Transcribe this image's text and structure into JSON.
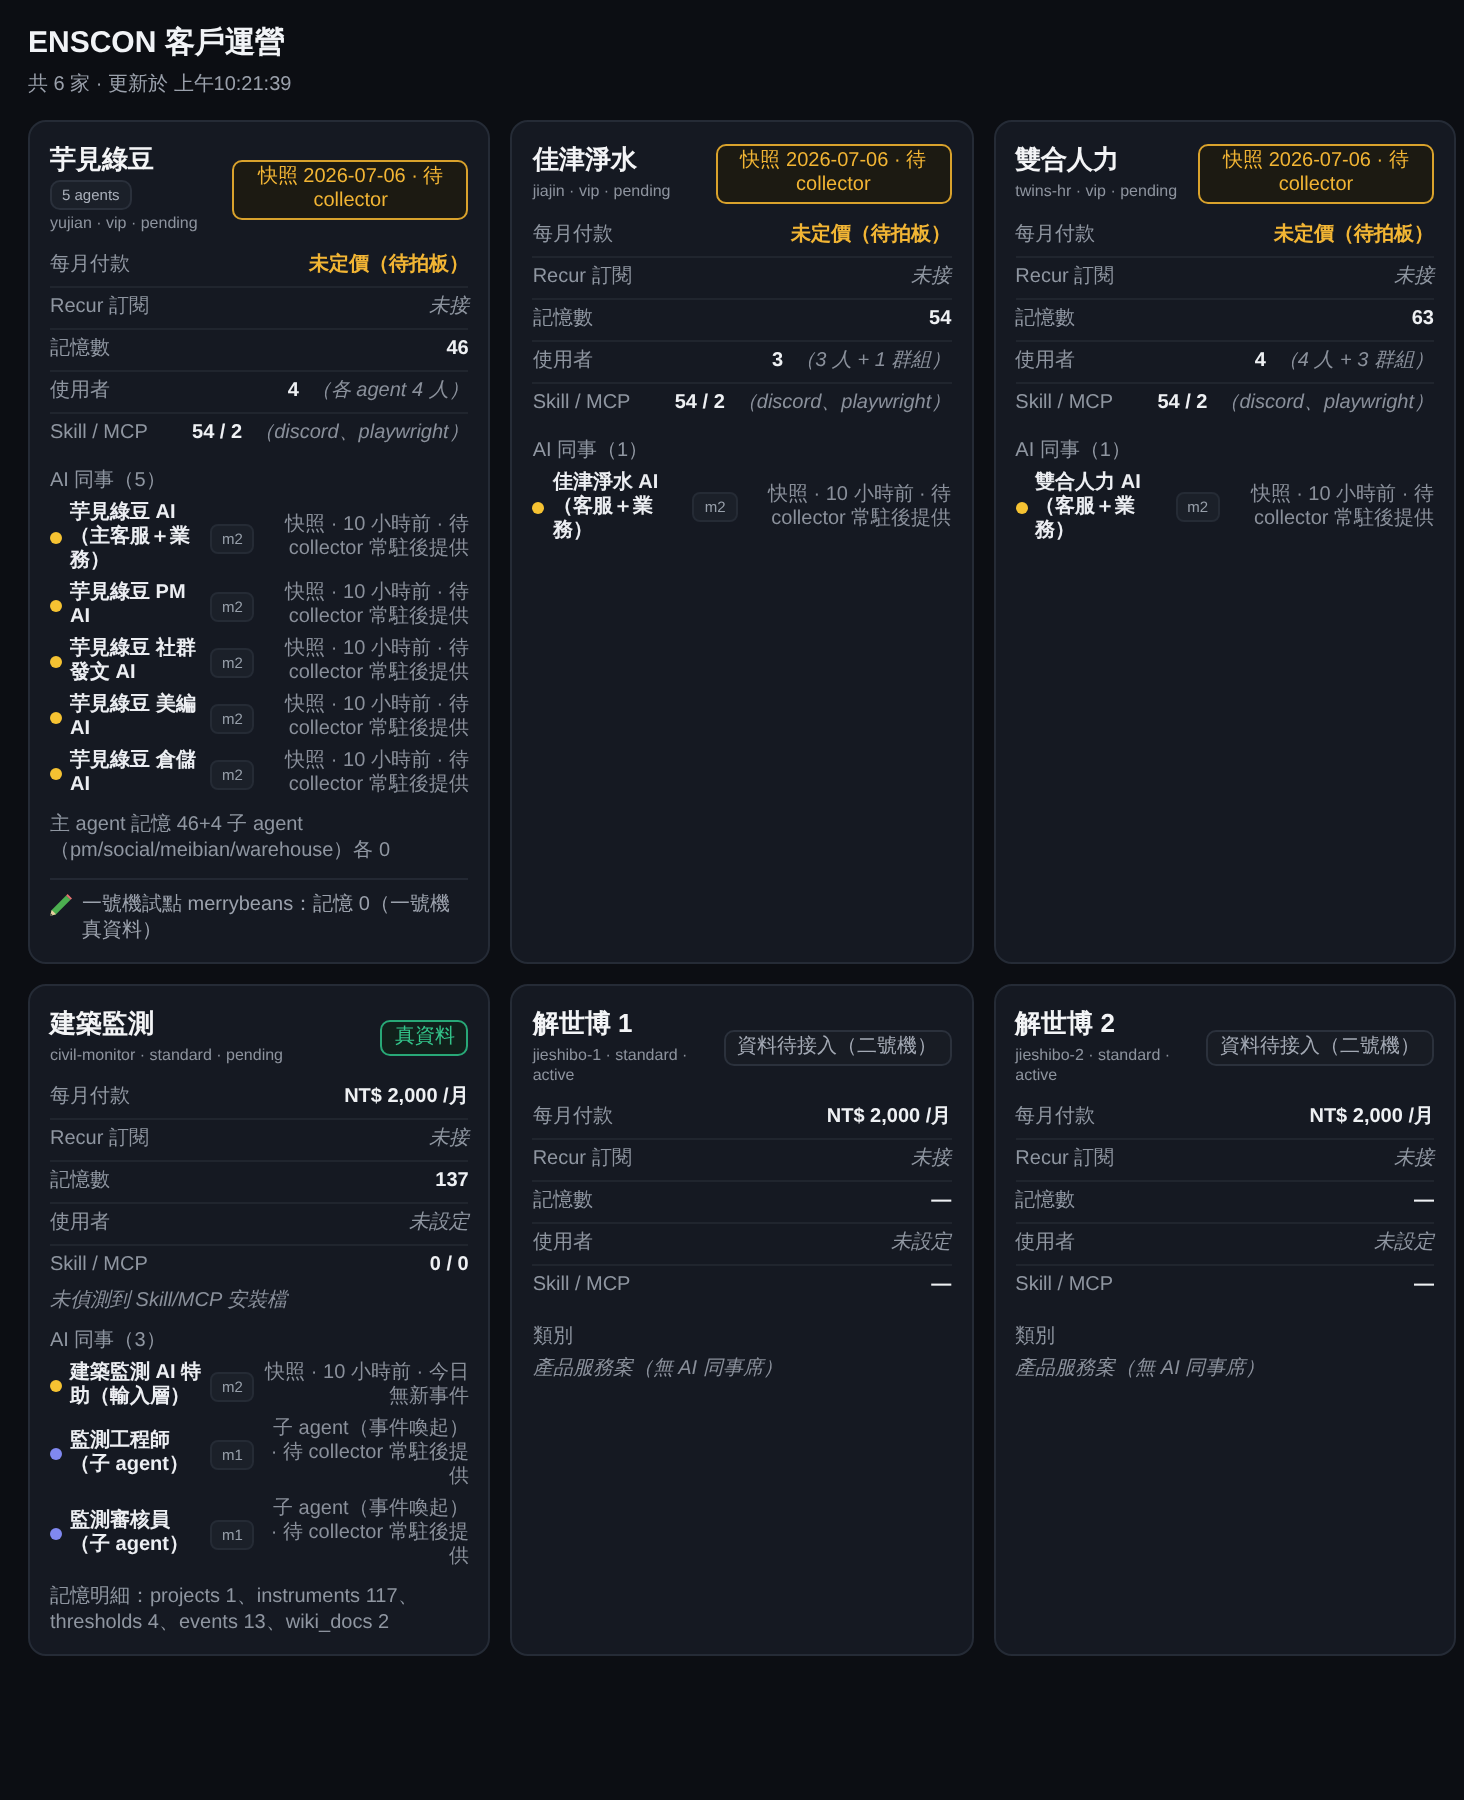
{
  "header": {
    "title": "ENSCON 客戶運營",
    "subtitle": "共 6 家 · 更新於 上午10:21:39"
  },
  "clients": [
    {
      "name": "芋見綠豆",
      "agent_count": "5 agents",
      "meta": "yujian · vip · pending",
      "badge": {
        "kind": "snapshot",
        "text": "快照 2026-07-06 · 待 collector"
      },
      "fields": [
        {
          "label": "每月付款",
          "value": "未定價（待拍板）",
          "kind": "price"
        },
        {
          "label": "Recur 訂閱",
          "value": "未接",
          "kind": "muted"
        },
        {
          "label": "記憶數",
          "value": "46",
          "kind": "strong"
        },
        {
          "label": "使用者",
          "value": "4",
          "kind": "strong",
          "note": "（各 agent 4 人）"
        },
        {
          "label": "Skill / MCP",
          "value": "54 / 2",
          "kind": "strong",
          "note": "（discord、playwright）"
        }
      ],
      "ai_team": {
        "title": "AI 同事（5）",
        "agents": [
          {
            "name": "芋見綠豆 AI（主客服＋業務）",
            "model": "m2",
            "status": "快照 · 10 小時前 · 待 collector 常駐後提供",
            "color": "#f5c232"
          },
          {
            "name": "芋見綠豆 PM AI",
            "model": "m2",
            "status": "快照 · 10 小時前 · 待 collector 常駐後提供",
            "color": "#f5c232"
          },
          {
            "name": "芋見綠豆 社群發文 AI",
            "model": "m2",
            "status": "快照 · 10 小時前 · 待 collector 常駐後提供",
            "color": "#f5c232"
          },
          {
            "name": "芋見綠豆 美編 AI",
            "model": "m2",
            "status": "快照 · 10 小時前 · 待 collector 常駐後提供",
            "color": "#f5c232"
          },
          {
            "name": "芋見綠豆 倉儲 AI",
            "model": "m2",
            "status": "快照 · 10 小時前 · 待 collector 常駐後提供",
            "color": "#f5c232"
          }
        ]
      },
      "notes": [
        {
          "kind": "detail",
          "text": "主 agent 記憶 46+4 子 agent（pm/social/meibian/warehouse）各 0"
        },
        {
          "kind": "pilot",
          "text": "一號機試點 merrybeans：記憶 0（一號機真資料）"
        }
      ]
    },
    {
      "name": "佳津淨水",
      "meta": "jiajin · vip · pending",
      "badge": {
        "kind": "snapshot",
        "text": "快照 2026-07-06 · 待 collector"
      },
      "fields": [
        {
          "label": "每月付款",
          "value": "未定價（待拍板）",
          "kind": "price"
        },
        {
          "label": "Recur 訂閱",
          "value": "未接",
          "kind": "muted"
        },
        {
          "label": "記憶數",
          "value": "54",
          "kind": "strong"
        },
        {
          "label": "使用者",
          "value": "3",
          "kind": "strong",
          "note": "（3 人 + 1 群組）"
        },
        {
          "label": "Skill / MCP",
          "value": "54 / 2",
          "kind": "strong",
          "note": "（discord、playwright）"
        }
      ],
      "ai_team": {
        "title": "AI 同事（1）",
        "agents": [
          {
            "name": "佳津淨水 AI（客服＋業務）",
            "model": "m2",
            "status": "快照 · 10 小時前 · 待 collector 常駐後提供",
            "color": "#f5c232"
          }
        ]
      }
    },
    {
      "name": "雙合人力",
      "meta": "twins-hr · vip · pending",
      "badge": {
        "kind": "snapshot",
        "text": "快照 2026-07-06 · 待 collector"
      },
      "fields": [
        {
          "label": "每月付款",
          "value": "未定價（待拍板）",
          "kind": "price"
        },
        {
          "label": "Recur 訂閱",
          "value": "未接",
          "kind": "muted"
        },
        {
          "label": "記憶數",
          "value": "63",
          "kind": "strong"
        },
        {
          "label": "使用者",
          "value": "4",
          "kind": "strong",
          "note": "（4 人 + 3 群組）"
        },
        {
          "label": "Skill / MCP",
          "value": "54 / 2",
          "kind": "strong",
          "note": "（discord、playwright）"
        }
      ],
      "ai_team": {
        "title": "AI 同事（1）",
        "agents": [
          {
            "name": "雙合人力 AI（客服＋業務）",
            "model": "m2",
            "status": "快照 · 10 小時前 · 待 collector 常駐後提供",
            "color": "#f5c232"
          }
        ]
      }
    },
    {
      "name": "建築監測",
      "meta": "civil-monitor · standard · pending",
      "badge": {
        "kind": "real",
        "text": "真資料"
      },
      "fields": [
        {
          "label": "每月付款",
          "value": "NT$ 2,000 /月",
          "kind": "strong"
        },
        {
          "label": "Recur 訂閱",
          "value": "未接",
          "kind": "muted"
        },
        {
          "label": "記憶數",
          "value": "137",
          "kind": "strong"
        },
        {
          "label": "使用者",
          "value": "未設定",
          "kind": "muted"
        },
        {
          "label": "Skill / MCP",
          "value": "0 / 0",
          "kind": "strong"
        }
      ],
      "skill_note": "未偵測到 Skill/MCP 安裝檔",
      "ai_team": {
        "title": "AI 同事（3）",
        "agents": [
          {
            "name": "建築監測 AI 特助（輸入層）",
            "model": "m2",
            "status": "快照 · 10 小時前 · 今日無新事件",
            "color": "#f5c232"
          },
          {
            "name": "監測工程師（子 agent）",
            "model": "m1",
            "status": "子 agent（事件喚起） · 待 collector 常駐後提供",
            "color": "#8088f0"
          },
          {
            "name": "監測審核員（子 agent）",
            "model": "m1",
            "status": "子 agent（事件喚起） · 待 collector 常駐後提供",
            "color": "#8088f0"
          }
        ]
      },
      "notes": [
        {
          "kind": "detail",
          "text": "記憶明細：projects 1、instruments 117、thresholds 4、events 13、wiki_docs 2"
        }
      ]
    },
    {
      "name": "解世博 1",
      "meta": "jieshibo-1 · standard · active",
      "badge": {
        "kind": "pending",
        "text": "資料待接入（二號機）"
      },
      "fields": [
        {
          "label": "每月付款",
          "value": "NT$ 2,000 /月",
          "kind": "strong"
        },
        {
          "label": "Recur 訂閱",
          "value": "未接",
          "kind": "muted"
        },
        {
          "label": "記憶數",
          "value": "—",
          "kind": "strong"
        },
        {
          "label": "使用者",
          "value": "未設定",
          "kind": "muted"
        },
        {
          "label": "Skill / MCP",
          "value": "—",
          "kind": "strong"
        }
      ],
      "category": {
        "label": "類別",
        "value": "產品服務案（無 AI 同事席）"
      }
    },
    {
      "name": "解世博 2",
      "meta": "jieshibo-2 · standard · active",
      "badge": {
        "kind": "pending",
        "text": "資料待接入（二號機）"
      },
      "fields": [
        {
          "label": "每月付款",
          "value": "NT$ 2,000 /月",
          "kind": "strong"
        },
        {
          "label": "Recur 訂閱",
          "value": "未接",
          "kind": "muted"
        },
        {
          "label": "記憶數",
          "value": "—",
          "kind": "strong"
        },
        {
          "label": "使用者",
          "value": "未設定",
          "kind": "muted"
        },
        {
          "label": "Skill / MCP",
          "value": "—",
          "kind": "strong"
        }
      ],
      "category": {
        "label": "類別",
        "value": "產品服務案（無 AI 同事席）"
      }
    }
  ]
}
